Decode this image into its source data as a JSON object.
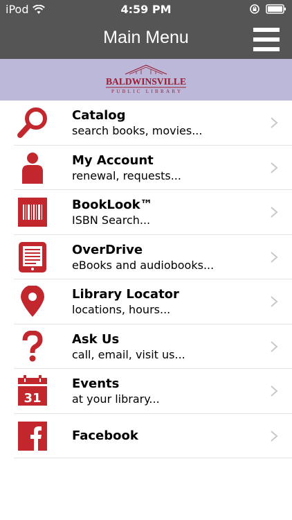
{
  "status_bar": {
    "carrier": "iPod",
    "time": "4:59 PM"
  },
  "nav": {
    "title": "Main Menu"
  },
  "banner": {
    "logo_line1": "BALDWINSVILLE",
    "logo_line2": "PUBLIC LIBRARY"
  },
  "menu": [
    {
      "title": "Catalog",
      "subtitle": "search books, movies...",
      "icon": "magnifier-icon"
    },
    {
      "title": "My Account",
      "subtitle": "renewal, requests...",
      "icon": "person-icon"
    },
    {
      "title": "BookLook™",
      "subtitle": "ISBN Search...",
      "icon": "barcode-icon"
    },
    {
      "title": "OverDrive",
      "subtitle": "eBooks and audiobooks...",
      "icon": "ebook-reader-icon"
    },
    {
      "title": "Library Locator",
      "subtitle": "locations, hours...",
      "icon": "location-pin-icon"
    },
    {
      "title": "Ask Us",
      "subtitle": "call, email, visit us...",
      "icon": "question-mark-icon"
    },
    {
      "title": "Events",
      "subtitle": "at your library...",
      "icon": "calendar-icon",
      "calendar_day": "31"
    },
    {
      "title": "Facebook",
      "subtitle": "",
      "icon": "facebook-icon"
    }
  ],
  "colors": {
    "bar": "#555555",
    "banner": "#bcb8d9",
    "accent": "#c1272d"
  }
}
